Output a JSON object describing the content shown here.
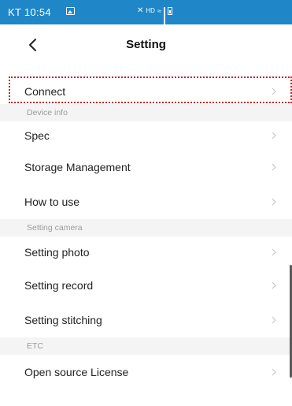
{
  "status_bar": {
    "time": "KT 10:54",
    "indicators": "✕ HD ✓",
    "background": "#1f86c8"
  },
  "header": {
    "title": "Setting",
    "back_icon": "chevron-left-icon"
  },
  "items": {
    "connect": "Connect",
    "spec": "Spec",
    "storage": "Storage Management",
    "how_to_use": "How to use",
    "setting_photo": "Setting photo",
    "setting_record": "Setting record",
    "setting_stitching": "Setting stitching",
    "open_source": "Open source License"
  },
  "sections": {
    "device_info": "Device info",
    "setting_camera": "Setting camera",
    "etc": "ETC"
  },
  "colors": {
    "highlight": "#c0262b",
    "section_bg": "#f4f4f4",
    "chevron": "#c8c8c8"
  }
}
